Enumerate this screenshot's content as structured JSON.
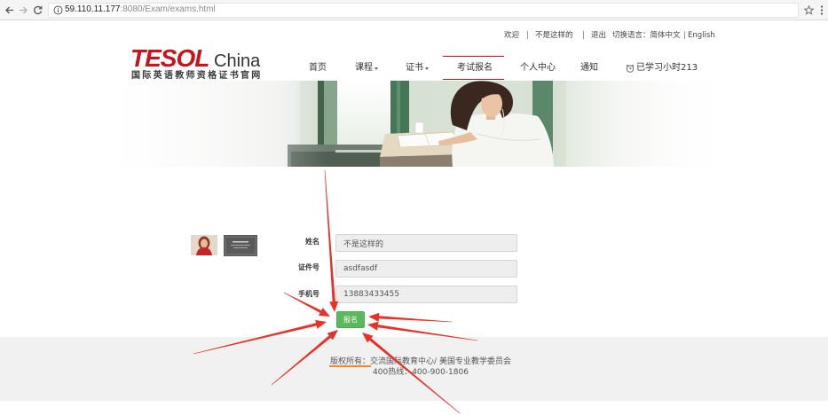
{
  "browser": {
    "url_host": "59.110.11.177",
    "url_path": ":8080/Exam/exams.html",
    "back_icon": "back-arrow-icon",
    "forward_icon": "forward-arrow-icon",
    "reload_icon": "reload-icon",
    "info_icon": "info-icon",
    "bookmark_icon": "star-icon",
    "menu_icon": "menu-icon"
  },
  "top_links": {
    "welcome": "欢迎",
    "separator": "|",
    "username": "不是这样的",
    "logout": "退出",
    "language_label": "切换语言：简体中文",
    "english": "English"
  },
  "logo": {
    "brand": "TESOL",
    "region": "China",
    "tagline": "国际英语教师资格证书官网"
  },
  "nav": {
    "items": [
      {
        "label": "首页"
      },
      {
        "label": "课程",
        "has_dropdown": true
      },
      {
        "label": "证书",
        "has_dropdown": true
      },
      {
        "label": "考试报名",
        "active": true
      },
      {
        "label": "个人中心"
      },
      {
        "label": "通知"
      },
      {
        "label": "已学习小时213",
        "icon": "clock-icon"
      }
    ]
  },
  "form": {
    "fields": [
      {
        "label": "姓名",
        "value": "不是这样的"
      },
      {
        "label": "证件号",
        "value": "asdfasdf"
      },
      {
        "label": "手机号",
        "value": "13883433455"
      }
    ],
    "submit_label": "报名"
  },
  "footer": {
    "copyright": "版权所有：交流国际教育中心/ 美国专业教学委员会",
    "hotline": "400热线：400-900-1806"
  },
  "colors": {
    "brand_red": "#c4161c",
    "submit_green": "#5cb85c",
    "annotation_arrow": "#e5332a",
    "annotation_underline": "#ef8b2c"
  }
}
